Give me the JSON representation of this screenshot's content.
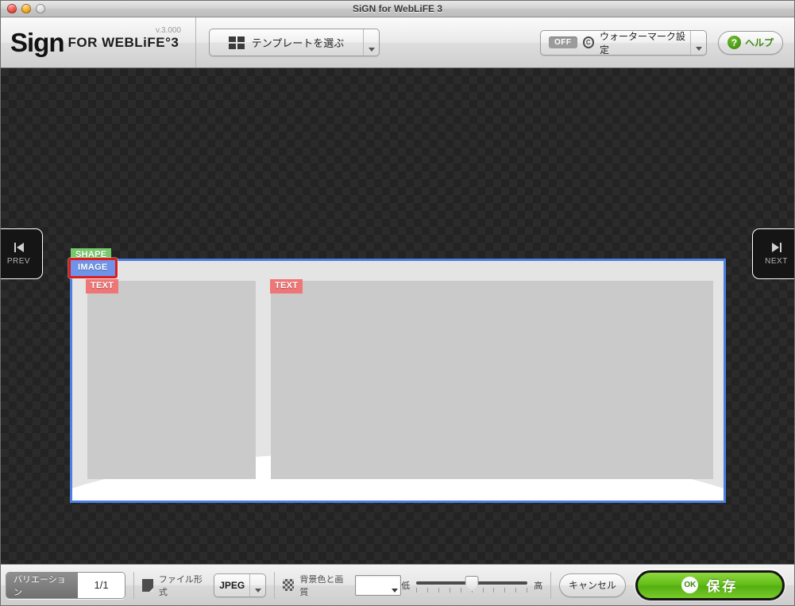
{
  "window": {
    "title": "SiGN for WebLiFE 3",
    "traffic_lights": [
      "close",
      "minimize",
      "zoom"
    ]
  },
  "toolbar": {
    "brand": {
      "logo": "Sign",
      "subtitle": "FOR WEBLiFE°3",
      "version": "v.3.000"
    },
    "template_button": {
      "label": "テンプレートを選ぶ",
      "icon": "grid-icon"
    },
    "watermark_button": {
      "state": "OFF",
      "label": "ウォーターマーク設定",
      "icon": "copyright-icon"
    },
    "help_button": {
      "label": "ヘルプ",
      "icon": "question-icon",
      "color": "#3f8a14"
    }
  },
  "canvas": {
    "prev_button": {
      "label": "PREV",
      "icon": "skip-back-icon"
    },
    "next_button": {
      "label": "NEXT",
      "icon": "skip-forward-icon"
    },
    "selection_color": "#4d7fe0",
    "tags": [
      {
        "label": "SHAPE",
        "color": "#76c96a",
        "selected": false
      },
      {
        "label": "IMAGE",
        "color": "#6e93e8",
        "selected": true,
        "outline_color": "#e01b1b"
      },
      {
        "label": "TEXT",
        "color": "#ef7676",
        "selected": false
      },
      {
        "label": "TEXT",
        "color": "#ef7676",
        "selected": false
      }
    ]
  },
  "bottombar": {
    "variation": {
      "label": "バリエーション",
      "value": "1/1"
    },
    "file_format": {
      "label": "ファイル形式",
      "value": "JPEG",
      "icon": "file-icon"
    },
    "background": {
      "label": "背景色と画質",
      "swatch_color": "#ffffff",
      "icon": "checker-icon"
    },
    "quality": {
      "low_label": "低",
      "high_label": "高",
      "value": 50,
      "ticks": 11
    },
    "cancel_button": "キャンセル",
    "save_button": {
      "label": "保存",
      "badge": "OK",
      "color": "#63bf18"
    }
  }
}
